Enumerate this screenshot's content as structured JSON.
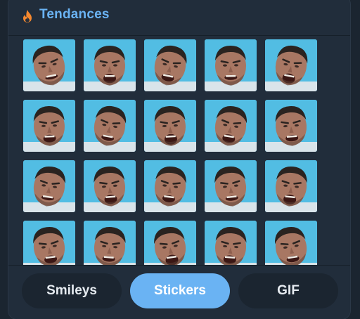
{
  "header": {
    "icon": "fire-icon",
    "title": "Tendances"
  },
  "stickers": {
    "rows": 4,
    "columns": 5,
    "items": [
      "sticker",
      "sticker",
      "sticker",
      "sticker",
      "sticker",
      "sticker",
      "sticker",
      "sticker",
      "sticker",
      "sticker",
      "sticker",
      "sticker",
      "sticker",
      "sticker",
      "sticker",
      "sticker",
      "sticker",
      "sticker",
      "sticker",
      "sticker"
    ]
  },
  "tabs": [
    {
      "label": "Smileys",
      "active": false
    },
    {
      "label": "Stickers",
      "active": true
    },
    {
      "label": "GIF",
      "active": false
    }
  ],
  "colors": {
    "accent": "#6ab3f3",
    "panel": "#212d3b",
    "background": "#1b2530",
    "sticker_bg": "#4fb7de"
  }
}
